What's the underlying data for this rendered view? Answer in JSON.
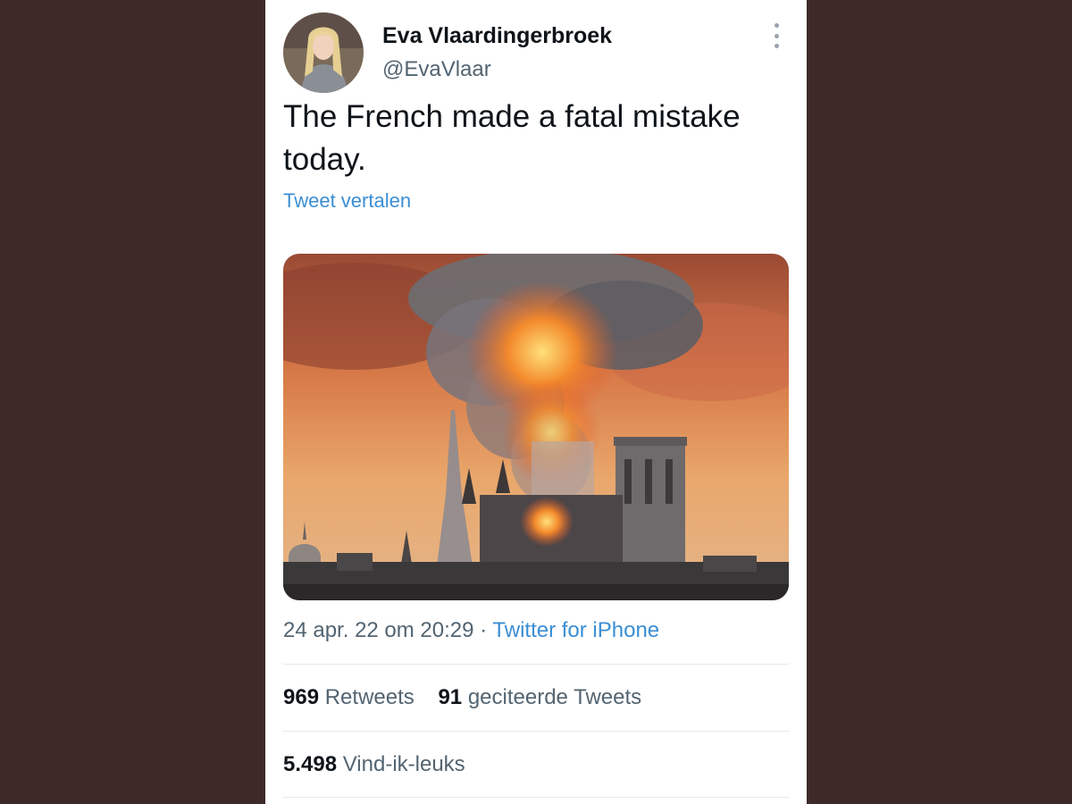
{
  "tweet": {
    "display_name": "Eva Vlaardingerbroek",
    "handle": "@EvaVlaar",
    "text": "The French made a fatal mistake today.",
    "translate_label": "Tweet vertalen",
    "date": "24 apr. 22 om 20:29",
    "separator": " · ",
    "source": "Twitter for iPhone",
    "retweets_count": "969",
    "retweets_label": "Retweets",
    "quotes_count": "91",
    "quotes_label": "geciteerde Tweets",
    "likes_count": "5.498",
    "likes_label": "Vind-ik-leuks"
  },
  "icons": {
    "more": "more-options-icon"
  },
  "colors": {
    "background": "#3d2a28",
    "link": "#3b8ed4",
    "text": "#0f1419",
    "secondary": "#536471"
  }
}
